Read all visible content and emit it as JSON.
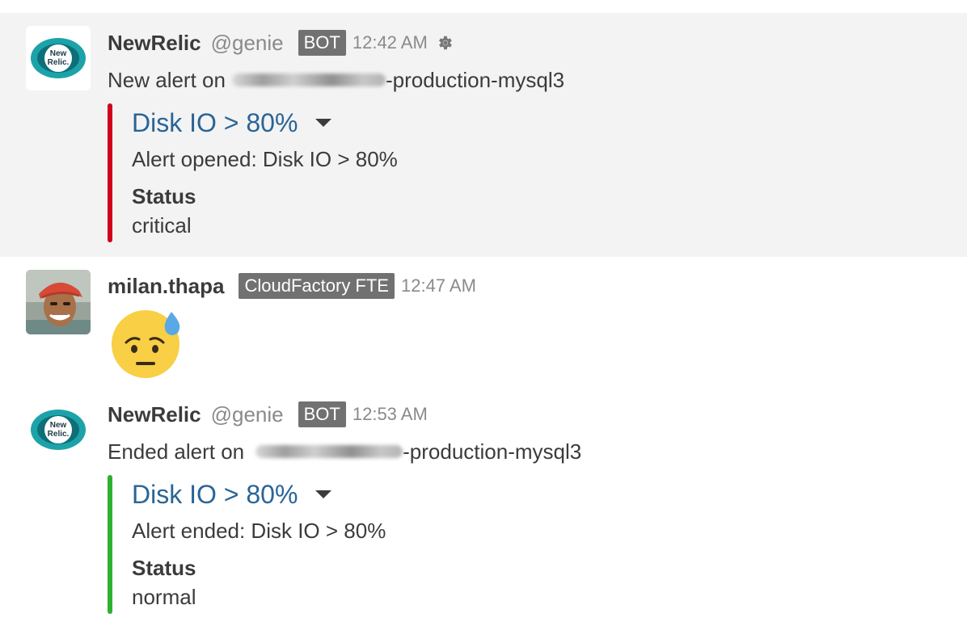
{
  "messages": [
    {
      "sender": "NewRelic",
      "handle": "@genie",
      "badge": "BOT",
      "time": "12:42 AM",
      "avatar_icon": "newrelic-logo",
      "has_settings_icon": true,
      "text_prefix": "New alert on",
      "text_suffix": "-production-mysql3",
      "attachment": {
        "title": "Disk IO > 80%",
        "text": "Alert opened: Disk IO > 80%",
        "field_label": "Status",
        "field_value": "critical",
        "bar_color": "#d0021b"
      }
    },
    {
      "sender": "milan.thapa",
      "badge": "CloudFactory FTE",
      "time": "12:47 AM",
      "avatar_icon": "user-photo",
      "emoji": "anxious-face-with-sweat-emoji"
    },
    {
      "sender": "NewRelic",
      "handle": "@genie",
      "badge": "BOT",
      "time": "12:53 AM",
      "avatar_icon": "newrelic-logo",
      "text_prefix": "Ended alert on",
      "text_suffix": "-production-mysql3",
      "attachment": {
        "title": "Disk IO > 80%",
        "text": "Alert ended: Disk IO > 80%",
        "field_label": "Status",
        "field_value": "normal",
        "bar_color": "#2fb12f"
      }
    }
  ],
  "logo_text": {
    "line1": "New",
    "line2": "Relic."
  },
  "colors": {
    "highlight_bg": "#f3f3f3",
    "link": "#2a6496",
    "badge_bg": "#717171",
    "newrelic_teal": "#1ca3a9"
  }
}
